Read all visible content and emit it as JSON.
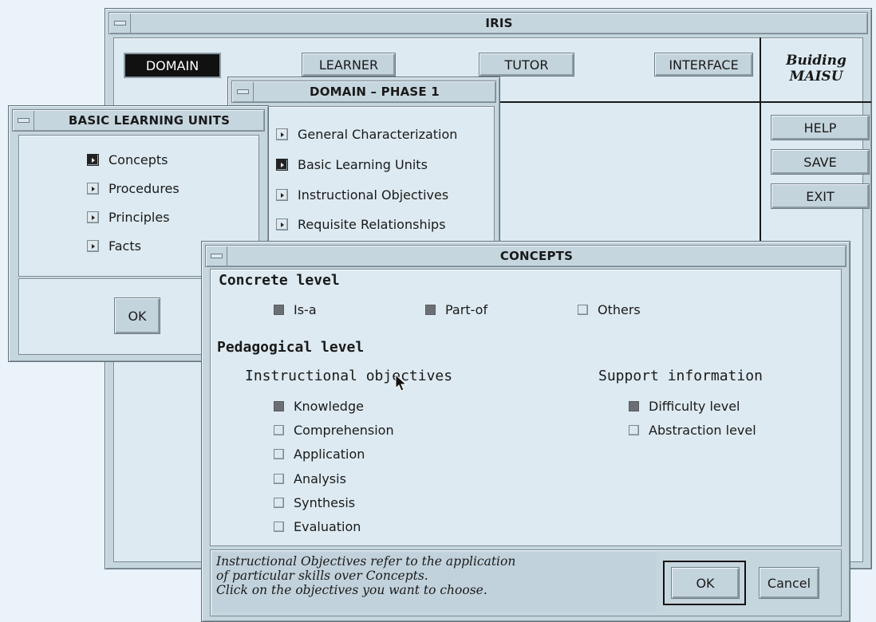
{
  "iris": {
    "title": "IRIS",
    "tabs": [
      "DOMAIN",
      "LEARNER",
      "TUTOR",
      "INTERFACE"
    ],
    "brand_line1": "Buiding",
    "brand_line2": "MAISU",
    "side_buttons": [
      "HELP",
      "SAVE",
      "EXIT"
    ]
  },
  "domain_phase": {
    "title": "DOMAIN – PHASE 1",
    "items": [
      "General Characterization",
      "Basic Learning Units",
      "Instructional Objectives",
      "Requisite Relationships"
    ]
  },
  "basic_units": {
    "title": "BASIC LEARNING UNITS",
    "items": [
      "Concepts",
      "Procedures",
      "Principles",
      "Facts"
    ],
    "ok_label": "OK"
  },
  "concepts": {
    "title": "CONCEPTS",
    "concrete_heading": "Concrete level",
    "concrete_options": [
      {
        "label": "Is-a",
        "checked": true
      },
      {
        "label": "Part-of",
        "checked": true
      },
      {
        "label": "Others",
        "checked": false
      }
    ],
    "pedagogical_heading": "Pedagogical level",
    "instructional_heading": "Instructional objectives",
    "objectives": [
      {
        "label": "Knowledge",
        "checked": true
      },
      {
        "label": "Comprehension",
        "checked": false
      },
      {
        "label": "Application",
        "checked": false
      },
      {
        "label": "Analysis",
        "checked": false
      },
      {
        "label": "Synthesis",
        "checked": false
      },
      {
        "label": "Evaluation",
        "checked": false
      }
    ],
    "support_heading": "Support information",
    "support": [
      {
        "label": "Difficulty level",
        "checked": true
      },
      {
        "label": "Abstraction level",
        "checked": false
      }
    ],
    "help_lines": [
      "Instructional Objectives refer to the application",
      "of particular skills over Concepts.",
      "Click on the objectives you want to choose."
    ],
    "ok_label": "OK",
    "cancel_label": "Cancel"
  },
  "colors": {
    "window_bg": "#c6d6df",
    "pane_bg": "#ddeaf1",
    "desktop": "#e9f3f9",
    "checked": "#6b6f74"
  },
  "icons": [
    "window-menu-icon",
    "arrow-icon",
    "mouse-pointer-icon"
  ]
}
